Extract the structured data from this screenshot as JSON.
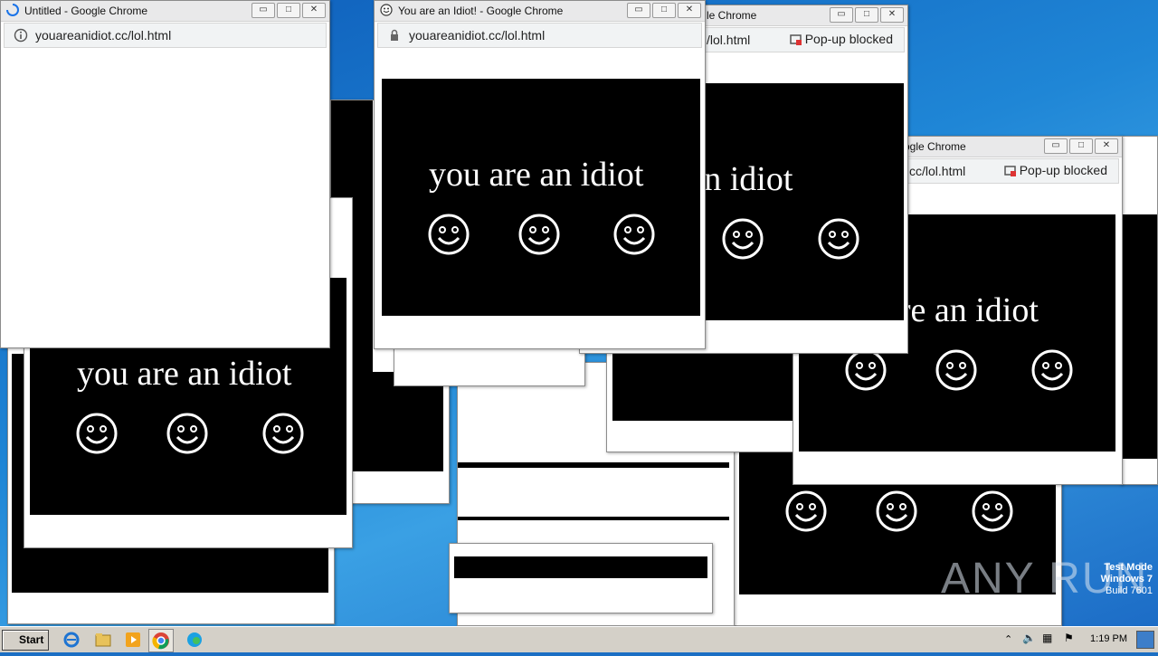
{
  "windows": {
    "untitled": {
      "title": "Untitled - Google Chrome",
      "url": "youareanidiot.cc/lol.html"
    },
    "main": {
      "title": "You are an Idiot! - Google Chrome",
      "url": "youareanidiot.cc/lol.html"
    },
    "mid": {
      "title_fragment": "le Chrome",
      "url_fragment": "/lol.html",
      "popup": "Pop-up blocked"
    },
    "right": {
      "title_fragment": "ogle Chrome",
      "url_fragment": "cc/lol.html",
      "popup": "Pop-up blocked"
    }
  },
  "message": "you are an idiot",
  "message_fragment": "are an idiot",
  "controls": {
    "minimize": "▭",
    "maximize": "□",
    "close": "✕"
  },
  "taskbar": {
    "start": "Start",
    "clock": "1:19 PM"
  },
  "watermark": {
    "line1": "Test Mode",
    "line2": "Windows 7",
    "line3": "Build 7601"
  },
  "brand": "ANY RUN"
}
